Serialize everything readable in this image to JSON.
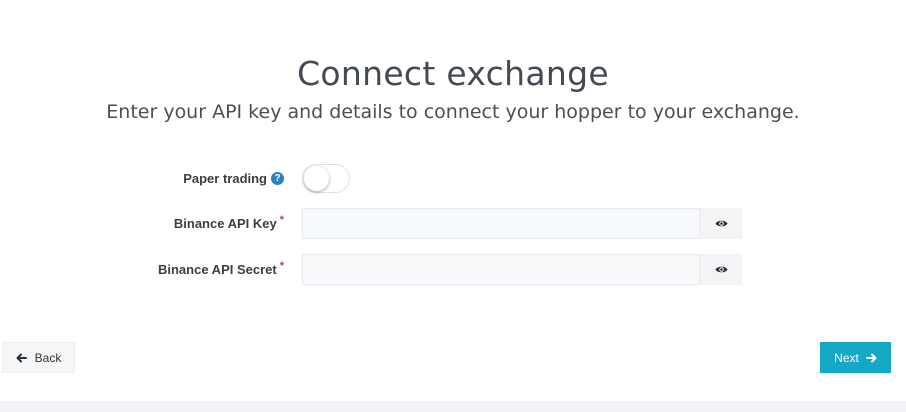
{
  "page": {
    "title": "Connect exchange",
    "subtitle": "Enter your API key and details to connect your hopper to your exchange."
  },
  "form": {
    "paper_trading": {
      "label": "Paper trading",
      "enabled": false,
      "help_icon": "question-circle-icon"
    },
    "api_key": {
      "label": "Binance API Key",
      "required_mark": "*",
      "value": "",
      "toggle_icon": "eye-icon"
    },
    "api_secret": {
      "label": "Binance API Secret",
      "required_mark": "*",
      "value": "",
      "toggle_icon": "eye-icon"
    }
  },
  "nav": {
    "back_label": "Back",
    "back_icon": "arrow-left-icon",
    "next_label": "Next",
    "next_icon": "arrow-right-icon"
  },
  "colors": {
    "accent": "#12a8c6",
    "required": "#d0364a",
    "help": "#2f7fc0"
  }
}
